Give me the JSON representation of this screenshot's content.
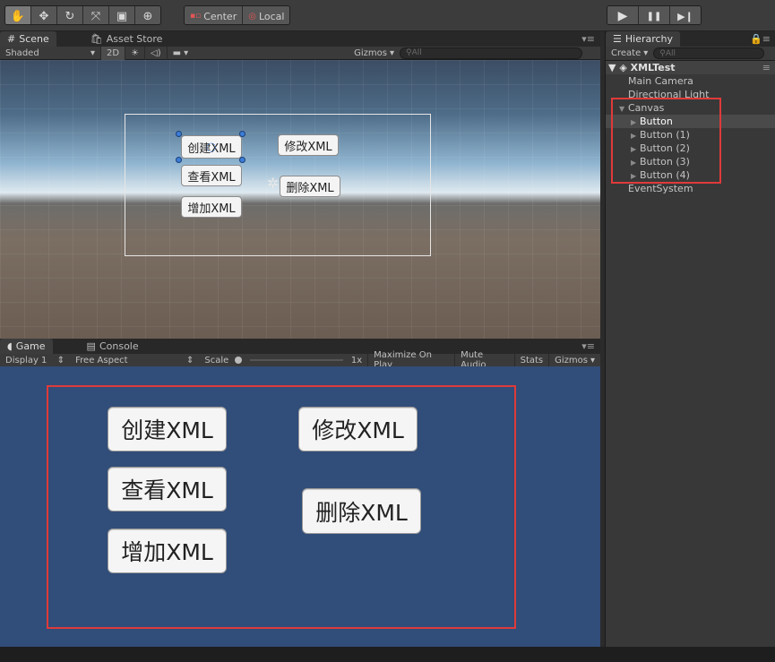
{
  "toolbar": {
    "tools": [
      {
        "icon": "hand-icon",
        "glyph": "✋"
      },
      {
        "icon": "move-icon",
        "glyph": "✥"
      },
      {
        "icon": "rotate-icon",
        "glyph": "↻"
      },
      {
        "icon": "scale-icon",
        "glyph": "⤧"
      },
      {
        "icon": "rect-tool-icon",
        "glyph": "▣"
      },
      {
        "icon": "transform-icon",
        "glyph": "⊕"
      }
    ],
    "pivot_label": "Center",
    "space_label": "Local",
    "play_glyph": "▶",
    "pause_glyph": "❚❚",
    "step_glyph": "▶❙"
  },
  "scene_panel": {
    "tab_scene": "Scene",
    "tab_asset_store": "Asset Store",
    "shading": "Shaded",
    "mode_2d": "2D",
    "gizmos": "Gizmos",
    "search_placeholder": "All",
    "buttons": {
      "create": "创建XML",
      "modify": "修改XML",
      "view": "查看XML",
      "delete": "删除XML",
      "add": "增加XML"
    }
  },
  "game_panel": {
    "tab_game": "Game",
    "tab_console": "Console",
    "display": "Display 1",
    "aspect": "Free Aspect",
    "scale_label": "Scale",
    "scale_value": "1x",
    "maximize": "Maximize On Play",
    "mute": "Mute Audio",
    "stats": "Stats",
    "gizmos": "Gizmos",
    "buttons": {
      "create": "创建XML",
      "modify": "修改XML",
      "view": "查看XML",
      "delete": "删除XML",
      "add": "增加XML"
    }
  },
  "hierarchy": {
    "tab": "Hierarchy",
    "create": "Create",
    "search_placeholder": "All",
    "scene_name": "XMLTest",
    "items": [
      {
        "label": "Main Camera",
        "depth": 1,
        "arrow": "",
        "selected": false
      },
      {
        "label": "Directional Light",
        "depth": 1,
        "arrow": "",
        "selected": false
      },
      {
        "label": "Canvas",
        "depth": 1,
        "arrow": "▼",
        "selected": false
      },
      {
        "label": "Button",
        "depth": 2,
        "arrow": "▶",
        "selected": true
      },
      {
        "label": "Button (1)",
        "depth": 2,
        "arrow": "▶",
        "selected": false
      },
      {
        "label": "Button (2)",
        "depth": 2,
        "arrow": "▶",
        "selected": false
      },
      {
        "label": "Button (3)",
        "depth": 2,
        "arrow": "▶",
        "selected": false
      },
      {
        "label": "Button (4)",
        "depth": 2,
        "arrow": "▶",
        "selected": false
      },
      {
        "label": "EventSystem",
        "depth": 1,
        "arrow": "",
        "selected": false
      }
    ]
  },
  "colors": {
    "game_background": "#314d79",
    "highlight_outline": "#e03a3a",
    "selection_handle": "#3c7dd6"
  }
}
